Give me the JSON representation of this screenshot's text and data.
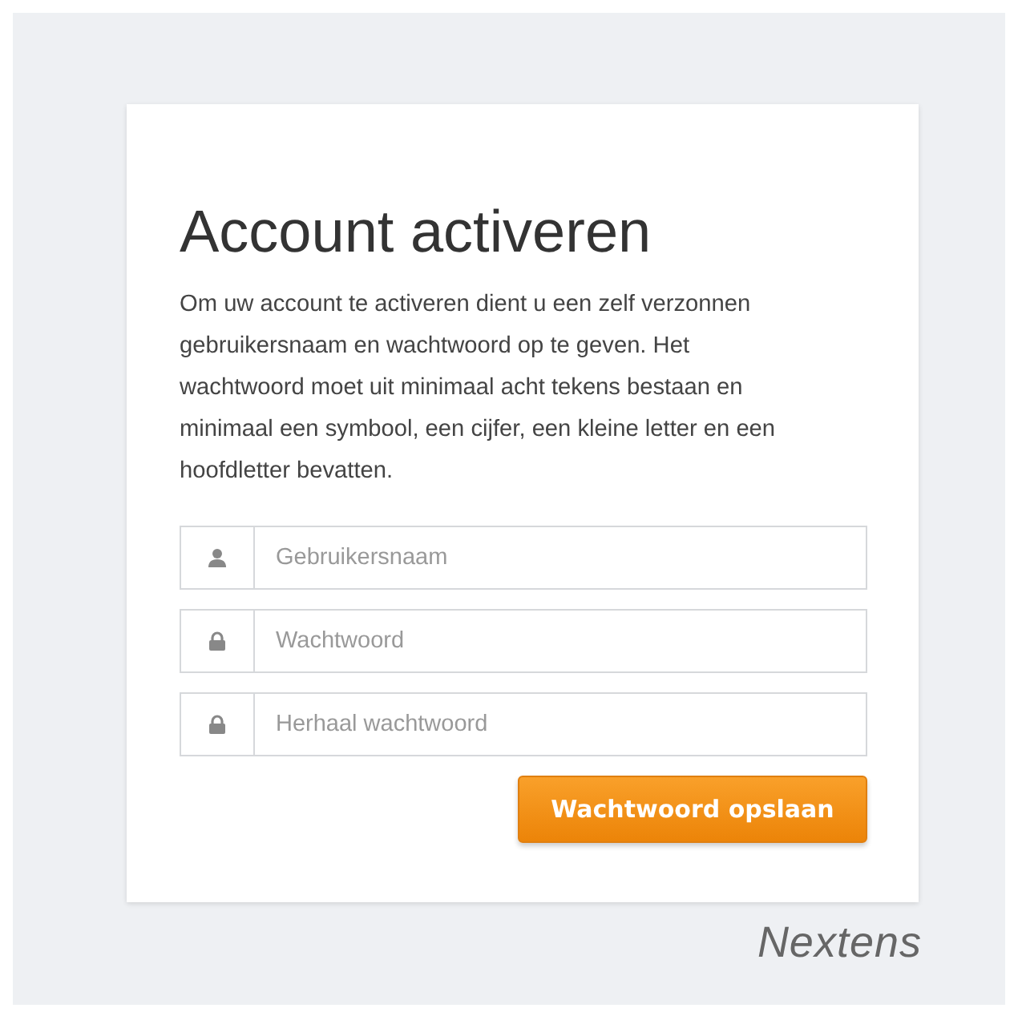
{
  "card": {
    "title": "Account activeren",
    "description": "Om uw account te activeren dient u een zelf verzonnen gebruikersnaam en wachtwoord op te geven. Het wachtwoord moet uit minimaal acht tekens bestaan en minimaal een symbool, een cijfer, een kleine letter en een hoofdletter bevatten.",
    "fields": [
      {
        "kind": "user",
        "placeholder": "Gebruikersnaam"
      },
      {
        "kind": "lock",
        "placeholder": "Wachtwoord"
      },
      {
        "kind": "lock",
        "placeholder": "Herhaal wachtwoord"
      }
    ],
    "button": "Wachtwoord opslaan"
  },
  "logo": "Nextens"
}
